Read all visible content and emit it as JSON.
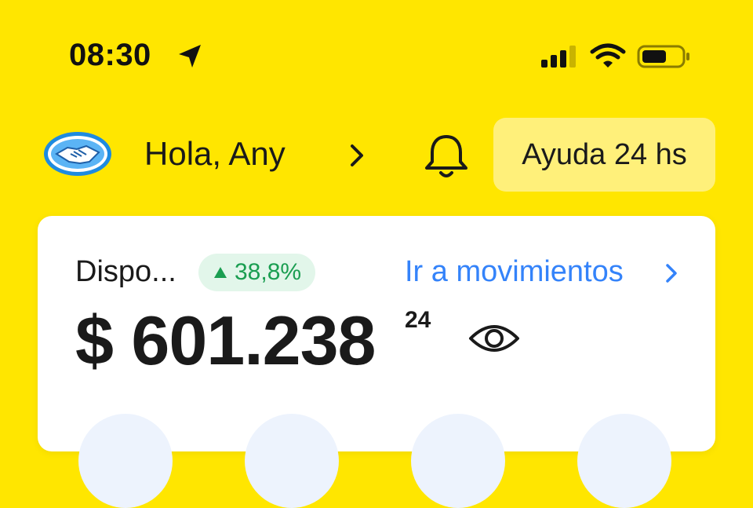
{
  "status_bar": {
    "time": "08:30",
    "icons": [
      "location-arrow-icon",
      "signal-icon",
      "wifi-icon",
      "battery-icon"
    ]
  },
  "header": {
    "greeting": "Hola, Any",
    "help_label": "Ayuda 24 hs",
    "icons": [
      "mercadopago-handshake-logo",
      "chevron-right-icon",
      "bell-icon"
    ]
  },
  "balance": {
    "label": "Dispo...",
    "trend_badge": "38,8%",
    "trend_direction": "up",
    "movements_link": "Ir a movimientos",
    "amount": "$ 601.238",
    "cents": "24"
  },
  "colors": {
    "background": "#FFE600",
    "help_button": "#FFF07A",
    "link": "#3483FA",
    "trend_green": "#1A9E51",
    "badge_bg": "#E2F6EA",
    "logo_blue": "#1E8BE0"
  }
}
